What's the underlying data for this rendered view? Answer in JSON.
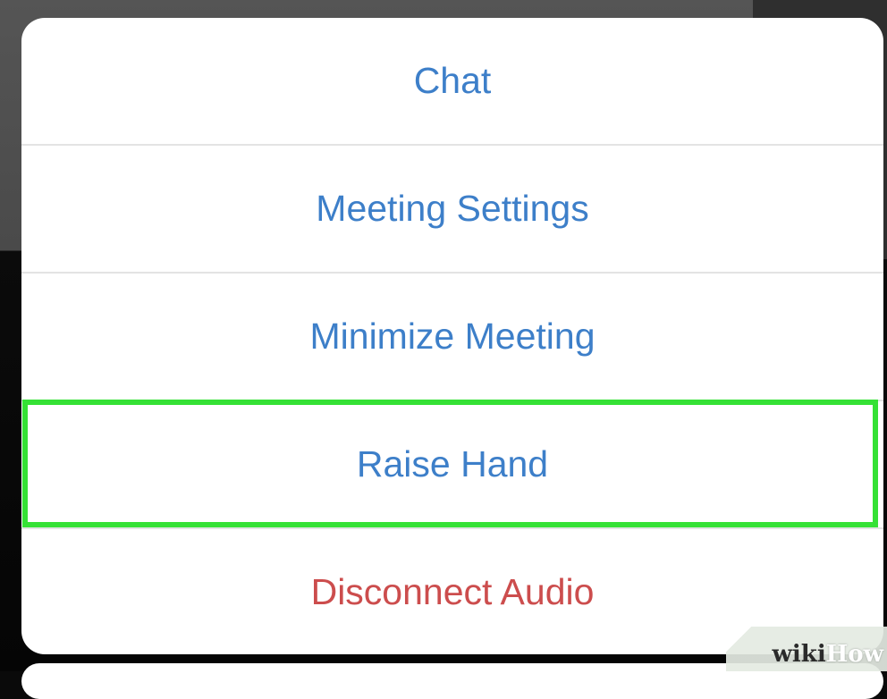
{
  "menu": {
    "items": [
      {
        "label": "Chat"
      },
      {
        "label": "Meeting Settings"
      },
      {
        "label": "Minimize Meeting"
      },
      {
        "label": "Raise Hand"
      },
      {
        "label": "Disconnect Audio"
      }
    ],
    "highlighted_item": "Raise Hand"
  },
  "watermark": {
    "part1": "wiki",
    "part2": "How"
  },
  "colors": {
    "action_text": "#3d7fc9",
    "destructive_text": "#cc4d4d",
    "highlight": "#35e135",
    "sheet_background": "#ffffff"
  }
}
